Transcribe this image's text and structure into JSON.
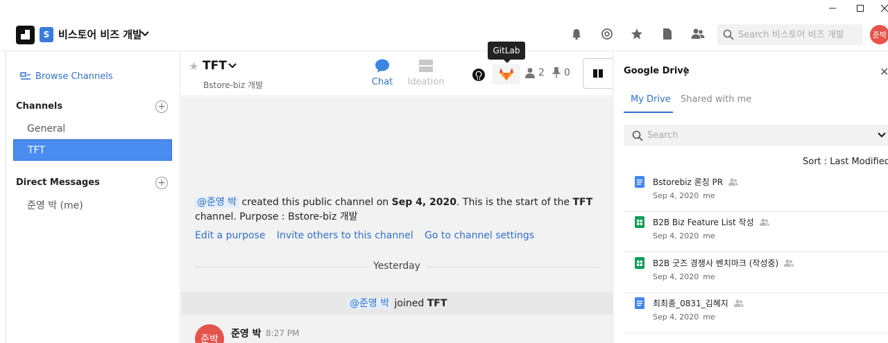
{
  "window": {
    "minimize": "—",
    "maximize": "☐",
    "close": "✕"
  },
  "header": {
    "workspace_badge": "S",
    "workspace_name": "비스토어 비즈 개발",
    "search_placeholder": "Search 비스토어 비즈 개발",
    "avatar_text": "준박"
  },
  "sidebar": {
    "browse_channels": "Browse Channels",
    "channels_title": "Channels",
    "channels": [
      {
        "label": "General",
        "active": false
      },
      {
        "label": "TFT",
        "active": true
      }
    ],
    "dm_title": "Direct Messages",
    "dms": [
      {
        "label": "준영 박 (me)"
      }
    ]
  },
  "channel": {
    "title": "TFT",
    "subtitle": "Bstore-biz 개발",
    "tabs": [
      {
        "label": "Chat",
        "active": true
      },
      {
        "label": "Ideation",
        "active": false
      }
    ],
    "tooltip": "GitLab",
    "member_count": "2",
    "pin_count": "0"
  },
  "messages": {
    "intro_mention": "@준영 박",
    "intro_text1": " created this public channel on ",
    "intro_date": "Sep 4, 2020",
    "intro_text2": ". This is the start of the ",
    "intro_channel": "TFT",
    "intro_text3": "channel. Purpose : Bstore-biz 개발",
    "links": [
      "Edit a purpose",
      "Invite others to this channel",
      "Go to channel settings"
    ],
    "divider": "Yesterday",
    "join_mention": "@준영 박",
    "join_text": " joined ",
    "join_channel": "TFT",
    "msg_avatar": "준박",
    "msg_author": "준영 박",
    "msg_time": "8:27 PM"
  },
  "drive": {
    "title": "Google Drive",
    "tabs": [
      {
        "label": "My Drive",
        "active": true
      },
      {
        "label": "Shared with me",
        "active": false
      }
    ],
    "search_placeholder": "Search",
    "sort_label": "Sort : Last Modified",
    "files": [
      {
        "name": "Bstorebiz 론칭 PR",
        "type": "doc",
        "date": "Sep 4, 2020",
        "owner": "me"
      },
      {
        "name": "B2B Biz Feature List 작성",
        "type": "sheet",
        "date": "Sep 4, 2020",
        "owner": "me"
      },
      {
        "name": "B2B 굿즈 경쟁사 벤치마크 (작성중)",
        "type": "sheet",
        "date": "Sep 4, 2020",
        "owner": "me"
      },
      {
        "name": "최최종_0831_김혜지",
        "type": "doc",
        "date": "Sep 4, 2020",
        "owner": "me"
      }
    ]
  },
  "colors": {
    "accent": "#2f6fd0",
    "active_channel": "#4a8cf0",
    "avatar": "#e5534b",
    "doc": "#4285f4",
    "sheet": "#0f9d58"
  }
}
